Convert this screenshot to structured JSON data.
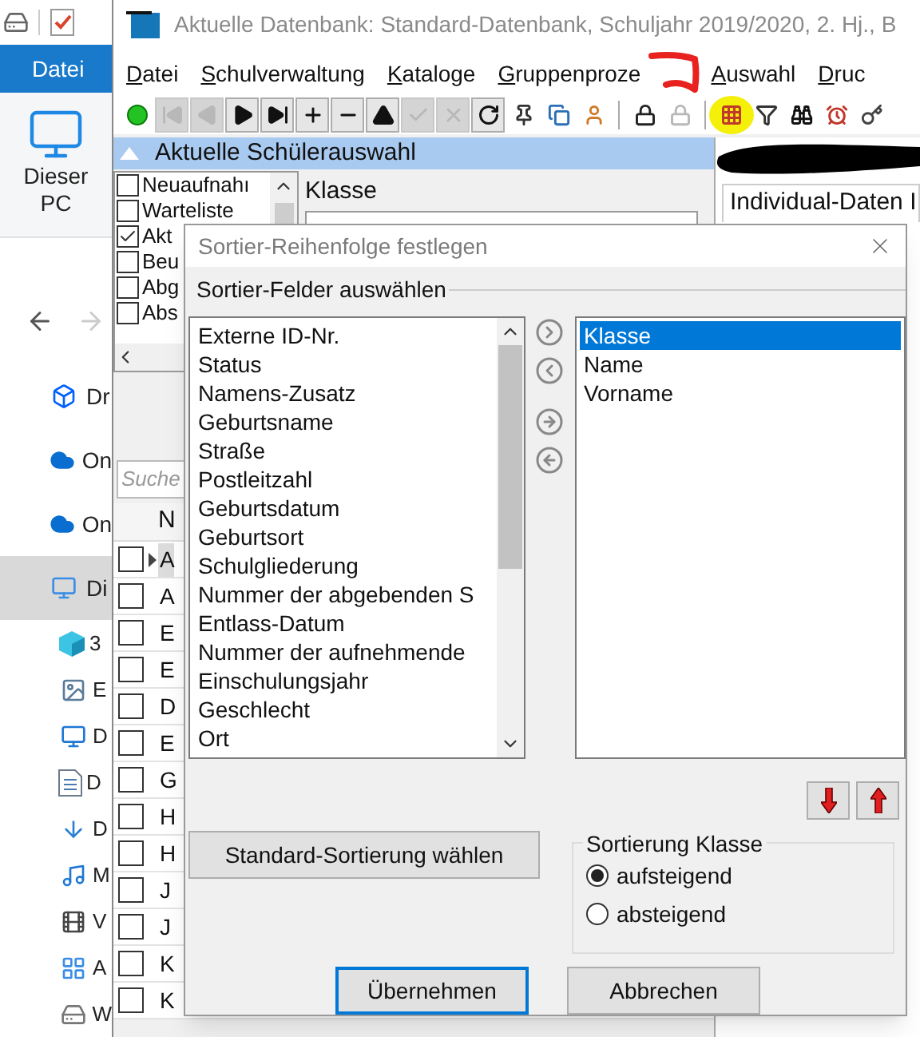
{
  "explorer": {
    "ribbon_tab": "Datei",
    "this_pc_label": "Dieser PC",
    "nav_items": [
      {
        "kind": "dropbox",
        "label": "Dr",
        "selected": false
      },
      {
        "kind": "cloud",
        "label": "On",
        "selected": false
      },
      {
        "kind": "cloud",
        "label": "On",
        "selected": false
      },
      {
        "kind": "pc",
        "label": "Di",
        "selected": true
      },
      {
        "kind": "cube",
        "label": "3",
        "selected": false
      },
      {
        "kind": "image",
        "label": "E",
        "selected": false
      },
      {
        "kind": "desktop",
        "label": "D",
        "selected": false
      },
      {
        "kind": "document",
        "label": "D",
        "selected": false
      },
      {
        "kind": "download",
        "label": "D",
        "selected": false
      },
      {
        "kind": "music",
        "label": "M",
        "selected": false
      },
      {
        "kind": "video",
        "label": "V",
        "selected": false
      },
      {
        "kind": "apps",
        "label": "A",
        "selected": false
      },
      {
        "kind": "drive",
        "label": "W",
        "selected": false
      }
    ]
  },
  "window": {
    "title": "Aktuelle Datenbank: Standard-Datenbank, Schuljahr 2019/2020, 2. Hj., B"
  },
  "menu": [
    "Datei",
    "Schulverwaltung",
    "Kataloge",
    "Gruppenproze",
    "Auswahl",
    "Druc"
  ],
  "toolbar": [
    [
      {
        "kind": "status",
        "disabled": false
      },
      {
        "kind": "first",
        "disabled": true
      },
      {
        "kind": "prev",
        "disabled": true
      },
      {
        "kind": "next",
        "disabled": false
      },
      {
        "kind": "last",
        "disabled": false
      },
      {
        "kind": "add",
        "disabled": false
      },
      {
        "kind": "remove",
        "disabled": false
      },
      {
        "kind": "up",
        "disabled": false
      },
      {
        "kind": "confirm",
        "disabled": true
      },
      {
        "kind": "cancel",
        "disabled": true
      },
      {
        "kind": "refresh",
        "disabled": false
      },
      {
        "kind": "pin",
        "disabled": false
      },
      {
        "kind": "copy",
        "disabled": false
      },
      {
        "kind": "person",
        "disabled": false
      }
    ],
    [
      {
        "kind": "lock",
        "disabled": false
      },
      {
        "kind": "lock",
        "disabled": true
      }
    ],
    [
      {
        "kind": "select",
        "disabled": false
      },
      {
        "kind": "filter",
        "disabled": false
      },
      {
        "kind": "binoculars",
        "disabled": false
      },
      {
        "kind": "alarm",
        "disabled": false
      },
      {
        "kind": "key",
        "disabled": false
      }
    ]
  ],
  "selection_panel": {
    "title": "Aktuelle Schülerauswahl",
    "filters": [
      {
        "label": "Neuaufnahı",
        "checked": false
      },
      {
        "label": "Warteliste",
        "checked": false
      },
      {
        "label": "Akt",
        "checked": true
      },
      {
        "label": "Beu",
        "checked": false
      },
      {
        "label": "Abg",
        "checked": false
      },
      {
        "label": "Abs",
        "checked": false
      }
    ],
    "class_label": "Klasse"
  },
  "search": {
    "placeholder": "Suche"
  },
  "table": {
    "columns": [
      "N"
    ],
    "rows": [
      {
        "cell": "A",
        "checked": false,
        "current": true
      },
      {
        "cell": "A",
        "checked": false,
        "current": false
      },
      {
        "cell": "E",
        "checked": false,
        "current": false
      },
      {
        "cell": "E",
        "checked": false,
        "current": false
      },
      {
        "cell": "D",
        "checked": false,
        "current": false
      },
      {
        "cell": "E",
        "checked": false,
        "current": false
      },
      {
        "cell": "G",
        "checked": false,
        "current": false
      },
      {
        "cell": "H",
        "checked": false,
        "current": false
      },
      {
        "cell": "H",
        "checked": false,
        "current": false
      },
      {
        "cell": "J",
        "checked": false,
        "current": false
      },
      {
        "cell": "J",
        "checked": false,
        "current": false
      },
      {
        "cell": "K",
        "checked": false,
        "current": false
      },
      {
        "cell": "K",
        "checked": false,
        "current": false
      }
    ]
  },
  "detail_panel": {
    "tab": "Individual-Daten I"
  },
  "dialog": {
    "title": "Sortier-Reihenfolge festlegen",
    "group_label": "Sortier-Felder auswählen",
    "available": [
      {
        "label": "Externe ID-Nr.",
        "selected": false
      },
      {
        "label": "Status",
        "selected": false
      },
      {
        "label": "Namens-Zusatz",
        "selected": false
      },
      {
        "label": "Geburtsname",
        "selected": false
      },
      {
        "label": "Straße",
        "selected": false
      },
      {
        "label": "Postleitzahl",
        "selected": false
      },
      {
        "label": "Geburtsdatum",
        "selected": false
      },
      {
        "label": "Geburtsort",
        "selected": false
      },
      {
        "label": "Schulgliederung",
        "selected": false
      },
      {
        "label": "Nummer der abgebenden S",
        "selected": false
      },
      {
        "label": "Entlass-Datum",
        "selected": false
      },
      {
        "label": "Nummer der aufnehmende",
        "selected": false
      },
      {
        "label": "Einschulungsjahr",
        "selected": false
      },
      {
        "label": "Geschlecht",
        "selected": false
      },
      {
        "label": "Ort",
        "selected": false
      }
    ],
    "chosen": [
      {
        "label": "Klasse",
        "selected": true
      },
      {
        "label": "Name",
        "selected": false
      },
      {
        "label": "Vorname",
        "selected": false
      }
    ],
    "default_button": "Standard-Sortierung wählen",
    "order_group": {
      "title": "Sortierung Klasse",
      "options": [
        {
          "label": "aufsteigend",
          "selected": true
        },
        {
          "label": "absteigend",
          "selected": false
        }
      ]
    },
    "buttons": [
      {
        "label": "Übernehmen",
        "default": true
      },
      {
        "label": "Abbrechen",
        "default": false
      }
    ]
  }
}
